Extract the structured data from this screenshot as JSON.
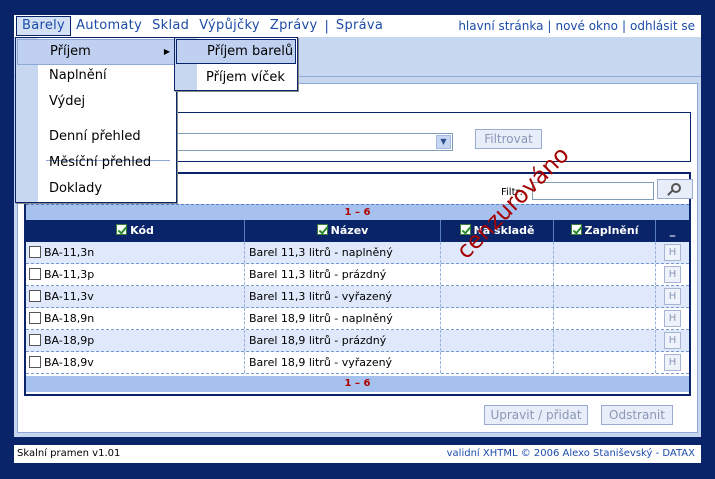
{
  "menubar": {
    "menus": [
      "Barely",
      "Automaty",
      "Sklad",
      "Výpůjčky",
      "Zprávy",
      "Správa"
    ],
    "links": [
      "hlavní stránka",
      "nové okno",
      "odhlásit se"
    ]
  },
  "dropdown": {
    "items": [
      "Příjem",
      "Naplnění",
      "Výdej",
      "Denní přehled",
      "Měsíční přehled",
      "Doklady"
    ]
  },
  "submenu": {
    "items": [
      "Příjem barelů",
      "Příjem víček"
    ]
  },
  "filter": {
    "button_label": "Filtrovat"
  },
  "grid": {
    "filtr_label": "Filtr:",
    "pager_text": "1 – 6",
    "columns": [
      "Kód",
      "Název",
      "Na skladě",
      "Zaplnění",
      "_"
    ],
    "rows": [
      {
        "kod": "BA-11,3n",
        "nazev": "Barel 11,3 litrů - naplněný",
        "h": "H"
      },
      {
        "kod": "BA-11,3p",
        "nazev": "Barel 11,3 litrů - prázdný",
        "h": "H"
      },
      {
        "kod": "BA-11,3v",
        "nazev": "Barel 11,3 litrů - vyřazený",
        "h": "H"
      },
      {
        "kod": "BA-18,9n",
        "nazev": "Barel 18,9 litrů - naplněný",
        "h": "H"
      },
      {
        "kod": "BA-18,9p",
        "nazev": "Barel 18,9 litrů - prázdný",
        "h": "H"
      },
      {
        "kod": "BA-18,9v",
        "nazev": "Barel 18,9 litrů - vyřazený",
        "h": "H"
      }
    ]
  },
  "actions": {
    "edit_add": "Upravit / přidat",
    "remove": "Odstranit"
  },
  "watermark": "cenzurováno",
  "footer": {
    "left": "Skalní pramen v1.01",
    "right": "validní XHTML © 2006 Alexo Staniševský - DATAX"
  },
  "colors": {
    "frame": "#0a246a",
    "panel": "#c7d7f0",
    "pager": "#a7c1ee",
    "link": "#1c4ca8",
    "watermark": "#a40000"
  }
}
